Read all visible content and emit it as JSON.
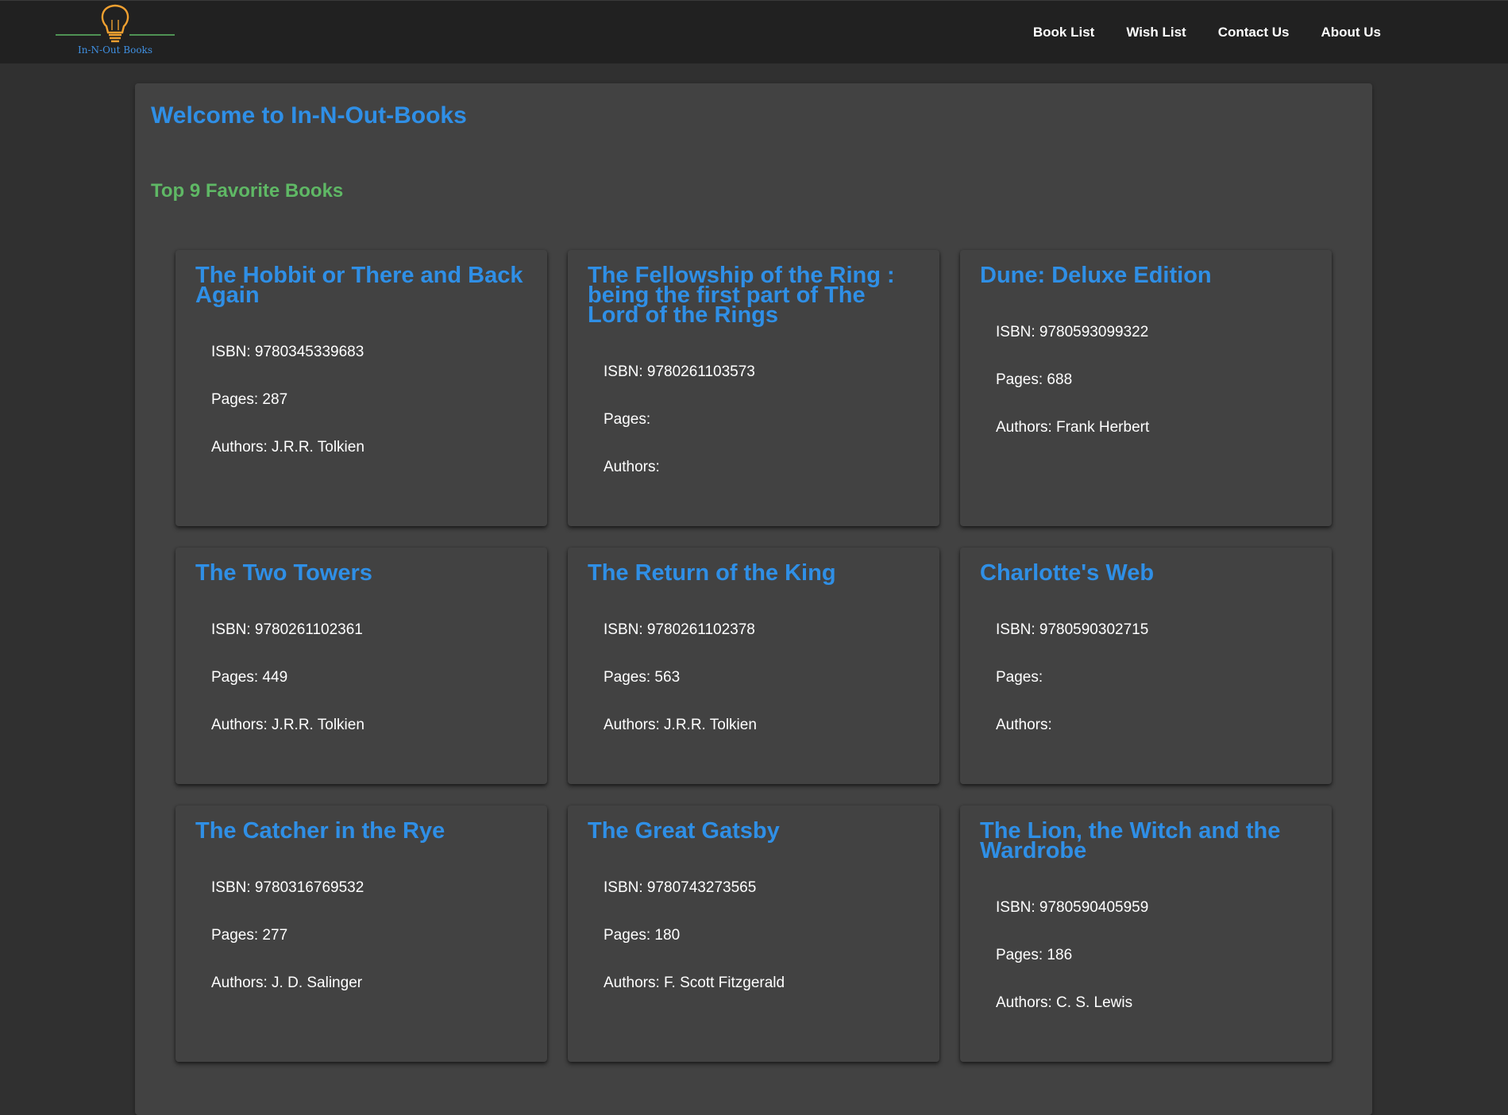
{
  "header": {
    "logo_text": "In-N-Out Books",
    "nav": [
      "Book List",
      "Wish List",
      "Contact Us",
      "About Us"
    ]
  },
  "main": {
    "welcome": "Welcome to In-N-Out-Books",
    "subtitle": "Top 9 Favorite Books"
  },
  "books": [
    {
      "title": "The Hobbit or There and Back Again",
      "isbn": "ISBN: 9780345339683",
      "pages": "Pages: 287",
      "authors": "Authors: J.R.R. Tolkien"
    },
    {
      "title": "The Fellowship of the Ring : being the first part of The Lord of the Rings",
      "isbn": "ISBN: 9780261103573",
      "pages": "Pages:",
      "authors": "Authors:"
    },
    {
      "title": "Dune: Deluxe Edition",
      "isbn": "ISBN: 9780593099322",
      "pages": "Pages: 688",
      "authors": "Authors: Frank Herbert"
    },
    {
      "title": "The Two Towers",
      "isbn": "ISBN: 9780261102361",
      "pages": "Pages: 449",
      "authors": "Authors: J.R.R. Tolkien"
    },
    {
      "title": "The Return of the King",
      "isbn": "ISBN: 9780261102378",
      "pages": "Pages: 563",
      "authors": "Authors: J.R.R. Tolkien"
    },
    {
      "title": "Charlotte's Web",
      "isbn": "ISBN: 9780590302715",
      "pages": "Pages:",
      "authors": "Authors:"
    },
    {
      "title": "The Catcher in the Rye",
      "isbn": "ISBN: 9780316769532",
      "pages": "Pages: 277",
      "authors": "Authors: J. D. Salinger"
    },
    {
      "title": "The Great Gatsby",
      "isbn": "ISBN: 9780743273565",
      "pages": "Pages: 180",
      "authors": "Authors: F. Scott Fitzgerald"
    },
    {
      "title": "The Lion, the Witch and the Wardrobe",
      "isbn": "ISBN: 9780590405959",
      "pages": "Pages: 186",
      "authors": "Authors: C. S. Lewis"
    }
  ],
  "icons": {
    "logo": "lightbulb-icon"
  },
  "colors": {
    "accent_blue": "#2f8fe6",
    "accent_green": "#5fb865",
    "bulb_orange": "#f0a030",
    "background": "#303030",
    "panel": "#424242",
    "topbar": "#212121"
  }
}
